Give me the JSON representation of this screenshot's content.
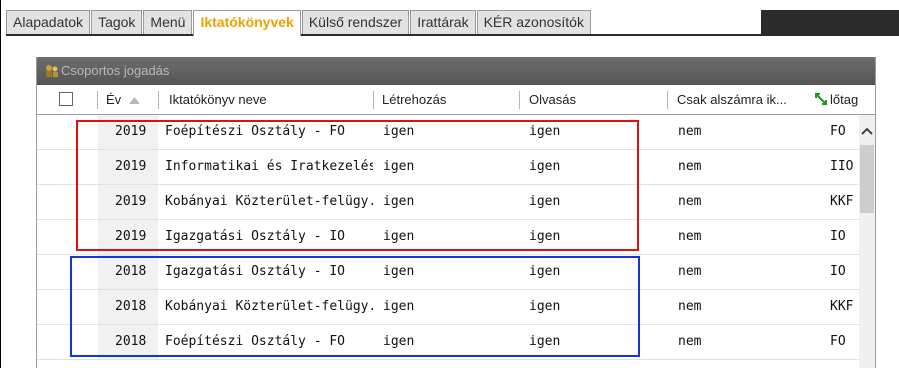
{
  "tabs": [
    {
      "label": "Alapadatok",
      "active": false
    },
    {
      "label": "Tagok",
      "active": false
    },
    {
      "label": "Menü",
      "active": false
    },
    {
      "label": "Iktatókönyvek",
      "active": true
    },
    {
      "label": "Külső rendszer",
      "active": false
    },
    {
      "label": "Irattárak",
      "active": false
    },
    {
      "label": "KÉR azonosítók",
      "active": false
    }
  ],
  "panel": {
    "title": "Csoportos jogadás",
    "icon": "group-permission-icon"
  },
  "columns": {
    "year": "Év",
    "name": "Iktatókönyv neve",
    "create": "Létrehozás",
    "read": "Olvasás",
    "only_sub": "Csak alszámra ik...",
    "tag": "lőtag"
  },
  "rows": [
    {
      "year": "2019",
      "name": "Foépítészi Osztály - FO",
      "create": "igen",
      "read": "igen",
      "only_sub": "nem",
      "tag": "FO"
    },
    {
      "year": "2019",
      "name": "Informatikai és Iratkezelési...",
      "create": "igen",
      "read": "igen",
      "only_sub": "nem",
      "tag": "IIO"
    },
    {
      "year": "2019",
      "name": "Kobányai Közterület-felügy...",
      "create": "igen",
      "read": "igen",
      "only_sub": "nem",
      "tag": "KKF"
    },
    {
      "year": "2019",
      "name": "Igazgatási Osztály - IO",
      "create": "igen",
      "read": "igen",
      "only_sub": "nem",
      "tag": "IO"
    },
    {
      "year": "2018",
      "name": "Igazgatási Osztály - IO",
      "create": "igen",
      "read": "igen",
      "only_sub": "nem",
      "tag": "IO"
    },
    {
      "year": "2018",
      "name": "Kobányai Közterület-felügy...",
      "create": "igen",
      "read": "igen",
      "only_sub": "nem",
      "tag": "KKF"
    },
    {
      "year": "2018",
      "name": "Foépítészi Osztály - FO",
      "create": "igen",
      "read": "igen",
      "only_sub": "nem",
      "tag": "FO"
    }
  ],
  "colors": {
    "active_tab": "#f0a000",
    "highlight_red": "#e01010",
    "highlight_blue": "#1436d6"
  }
}
